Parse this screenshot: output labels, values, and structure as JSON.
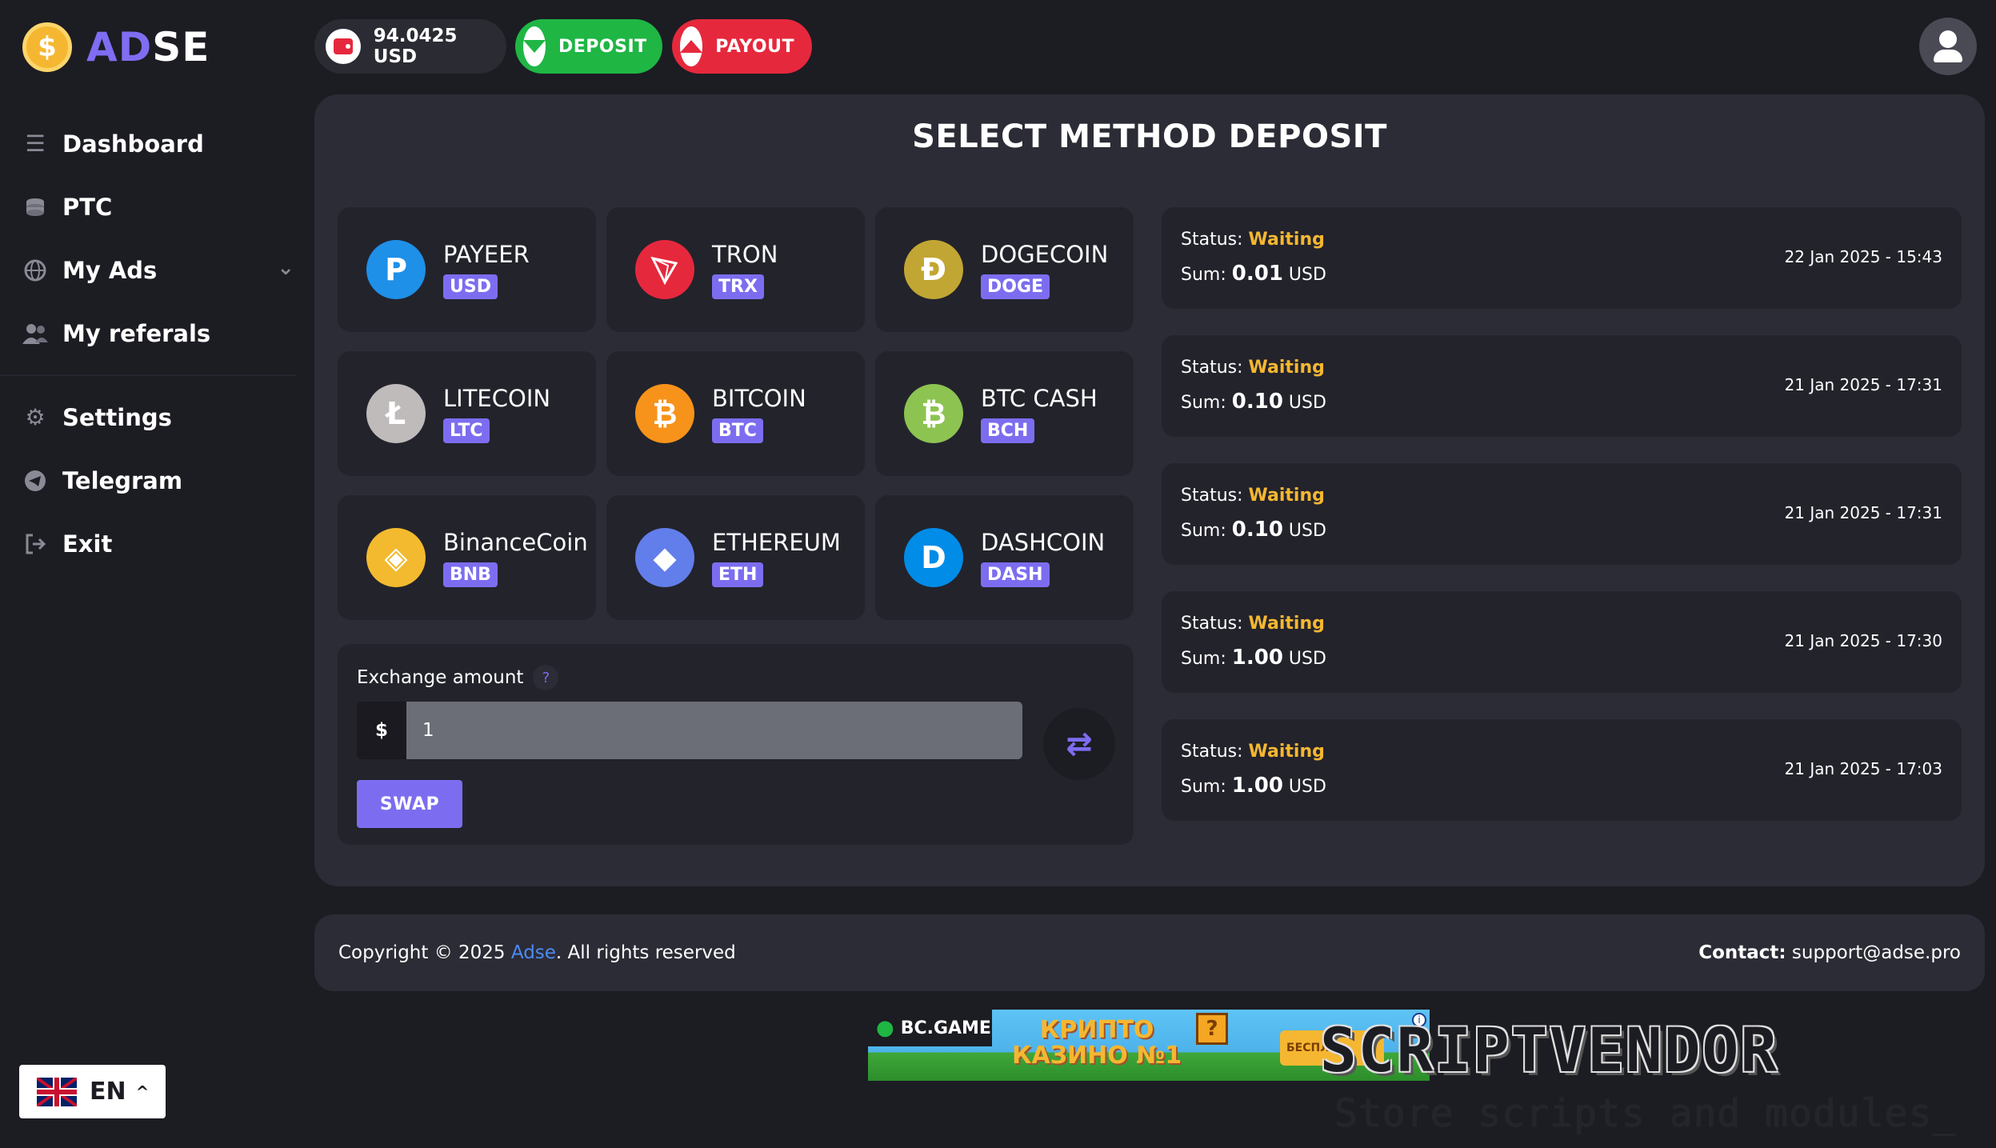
{
  "brand": {
    "ad": "AD",
    "se": "SE",
    "coin_glyph": "$"
  },
  "nav": {
    "items": [
      {
        "label": "Dashboard",
        "icon": "menu-icon"
      },
      {
        "label": "PTC",
        "icon": "coins-icon"
      },
      {
        "label": "My Ads",
        "icon": "globe-icon"
      },
      {
        "label": "My referals",
        "icon": "users-icon"
      }
    ],
    "secondary": [
      {
        "label": "Settings",
        "icon": "gear-icon"
      },
      {
        "label": "Telegram",
        "icon": "telegram-icon"
      },
      {
        "label": "Exit",
        "icon": "exit-icon"
      }
    ]
  },
  "language": {
    "code": "EN"
  },
  "topbar": {
    "balance": "94.0425 USD",
    "deposit_label": "DEPOSIT",
    "payout_label": "PAYOUT"
  },
  "main": {
    "title": "SELECT METHOD DEPOSIT",
    "methods": [
      {
        "name": "PAYEER",
        "tag": "USD",
        "color": "#1e90e8",
        "glyph": "P"
      },
      {
        "name": "TRON",
        "tag": "TRX",
        "color": "#e6283d",
        "glyph": "▽"
      },
      {
        "name": "DOGECOIN",
        "tag": "DOGE",
        "color": "#c2a633",
        "glyph": "Ð"
      },
      {
        "name": "LITECOIN",
        "tag": "LTC",
        "color": "#bfbbbb",
        "glyph": "Ł"
      },
      {
        "name": "BITCOIN",
        "tag": "BTC",
        "color": "#f7931a",
        "glyph": "₿"
      },
      {
        "name": "BTC CASH",
        "tag": "BCH",
        "color": "#8dc351",
        "glyph": "₿"
      },
      {
        "name": "BinanceCoin",
        "tag": "BNB",
        "color": "#f3ba2f",
        "glyph": "◈"
      },
      {
        "name": "ETHEREUM",
        "tag": "ETH",
        "color": "#627eea",
        "glyph": "◆"
      },
      {
        "name": "DASHCOIN",
        "tag": "DASH",
        "color": "#008ce7",
        "glyph": "D"
      }
    ],
    "exchange": {
      "label": "Exchange amount",
      "help": "?",
      "prefix": "$",
      "value": "1",
      "swap_label": "SWAP"
    },
    "history": [
      {
        "status_label": "Status:",
        "status": "Waiting",
        "sum_label": "Sum:",
        "amount": "0.01",
        "currency": "USD",
        "date": "22 Jan 2025 - 15:43"
      },
      {
        "status_label": "Status:",
        "status": "Waiting",
        "sum_label": "Sum:",
        "amount": "0.10",
        "currency": "USD",
        "date": "21 Jan 2025 - 17:31"
      },
      {
        "status_label": "Status:",
        "status": "Waiting",
        "sum_label": "Sum:",
        "amount": "0.10",
        "currency": "USD",
        "date": "21 Jan 2025 - 17:31"
      },
      {
        "status_label": "Status:",
        "status": "Waiting",
        "sum_label": "Sum:",
        "amount": "1.00",
        "currency": "USD",
        "date": "21 Jan 2025 - 17:30"
      },
      {
        "status_label": "Status:",
        "status": "Waiting",
        "sum_label": "Sum:",
        "amount": "1.00",
        "currency": "USD",
        "date": "21 Jan 2025 - 17:03"
      }
    ]
  },
  "footer": {
    "copyright_prefix": "Copyright © 2025 ",
    "brand_link": "Adse",
    "copyright_suffix": ". All rights reserved",
    "contact_label": "Contact:",
    "contact_email": "support@adse.pro"
  },
  "ad_banner": {
    "logo": "BC.GAME",
    "line1": "КРИПТО",
    "line2": "КАЗИНО №1",
    "cta": "БЕСПЛ"
  },
  "watermark": {
    "title": "SCRIPTVENDOR",
    "subtitle": "Store scripts and modules_"
  }
}
